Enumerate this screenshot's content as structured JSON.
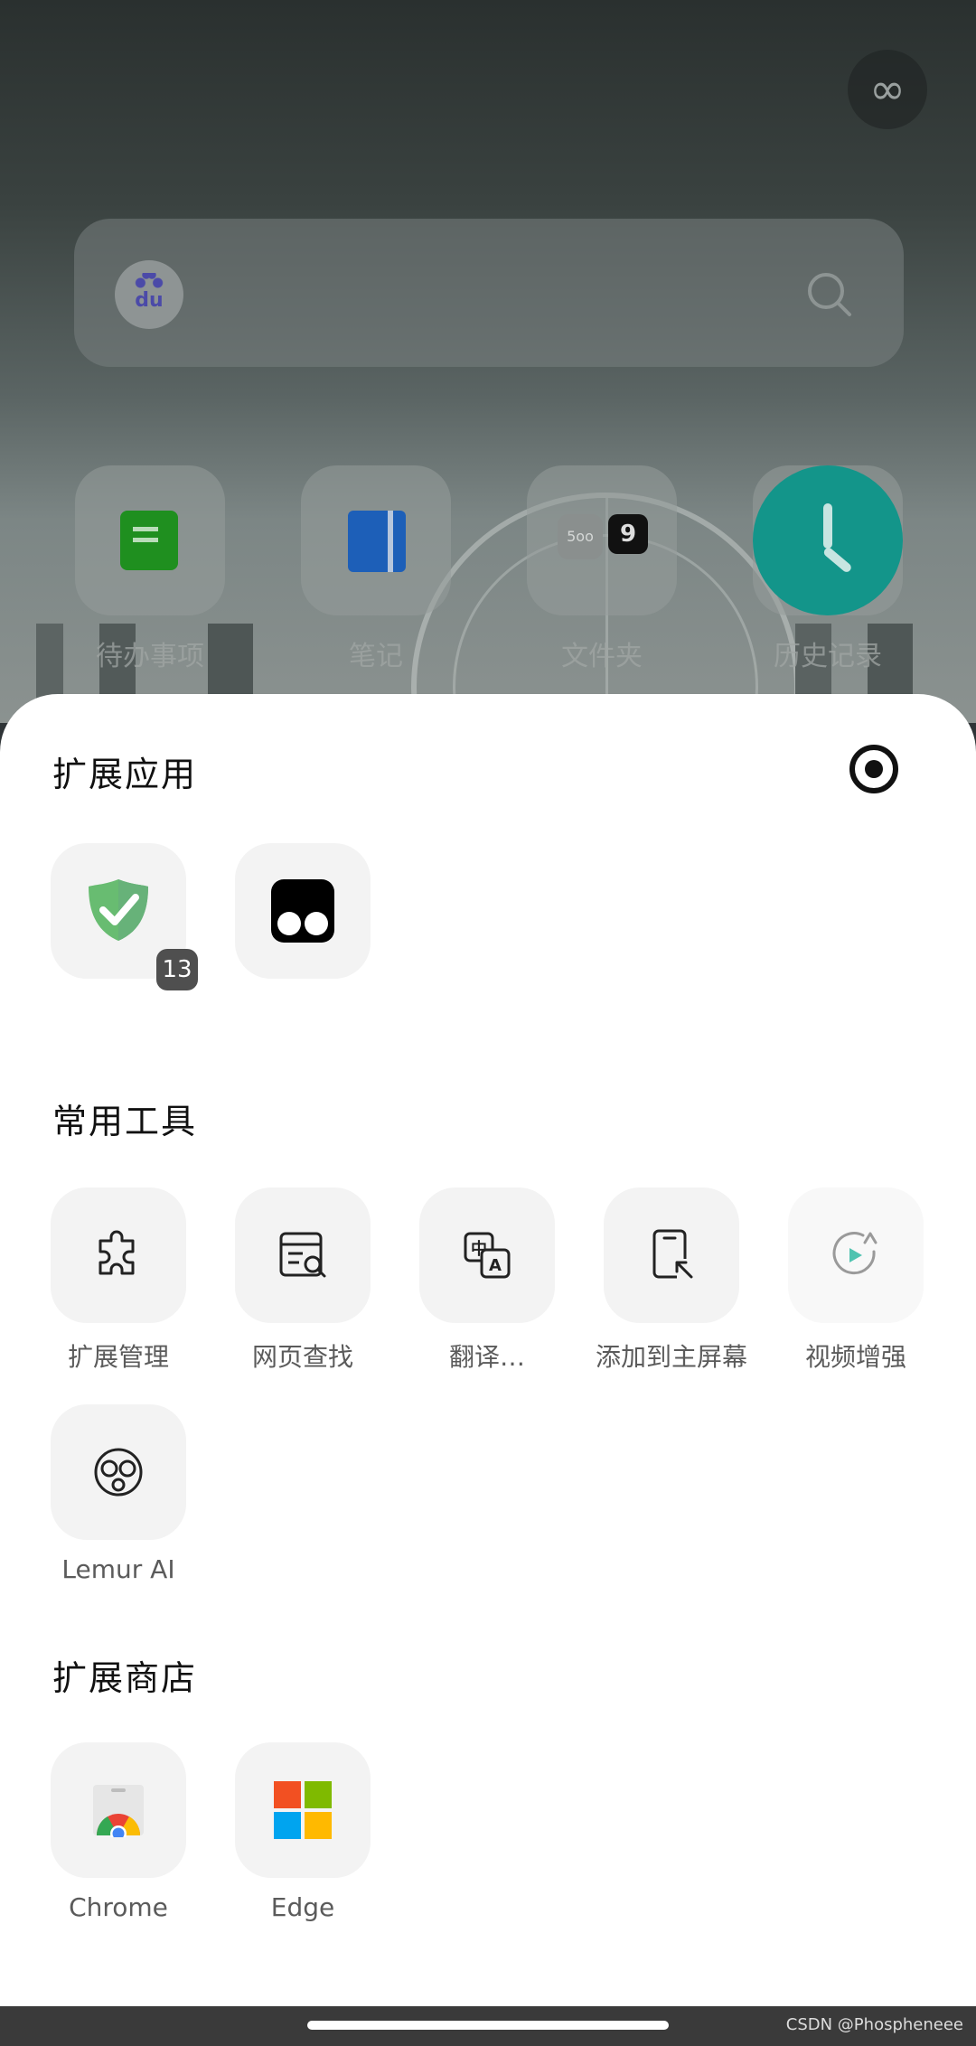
{
  "quick_links": [
    {
      "label": "待办事项",
      "icon": "todo-icon"
    },
    {
      "label": "笔记",
      "icon": "notes-icon"
    },
    {
      "label": "文件夹",
      "icon": "folder-icon"
    },
    {
      "label": "历史记录",
      "icon": "history-icon"
    }
  ],
  "search": {
    "logo_text": "du"
  },
  "folder_tile": {
    "badge_a": "5oo",
    "badge_b": "9"
  },
  "sections": {
    "extensions_title": "扩展应用",
    "tools_title": "常用工具",
    "store_title": "扩展商店"
  },
  "extension_apps": [
    {
      "name": "adguard",
      "badge": "13"
    },
    {
      "name": "tampermonkey"
    }
  ],
  "tools": [
    {
      "label": "扩展管理",
      "icon": "puzzle-icon"
    },
    {
      "label": "网页查找",
      "icon": "find-in-page-icon"
    },
    {
      "label": "翻译…",
      "icon": "translate-icon"
    },
    {
      "label": "添加到主屏幕",
      "icon": "add-to-home-icon"
    },
    {
      "label": "视频增强",
      "icon": "video-enhance-icon"
    },
    {
      "label": "Lemur AI",
      "icon": "lemur-ai-icon"
    }
  ],
  "stores": [
    {
      "label": "Chrome",
      "icon": "chrome-store-icon"
    },
    {
      "label": "Edge",
      "icon": "edge-store-icon"
    }
  ],
  "watermark": "CSDN @Phospheneee"
}
